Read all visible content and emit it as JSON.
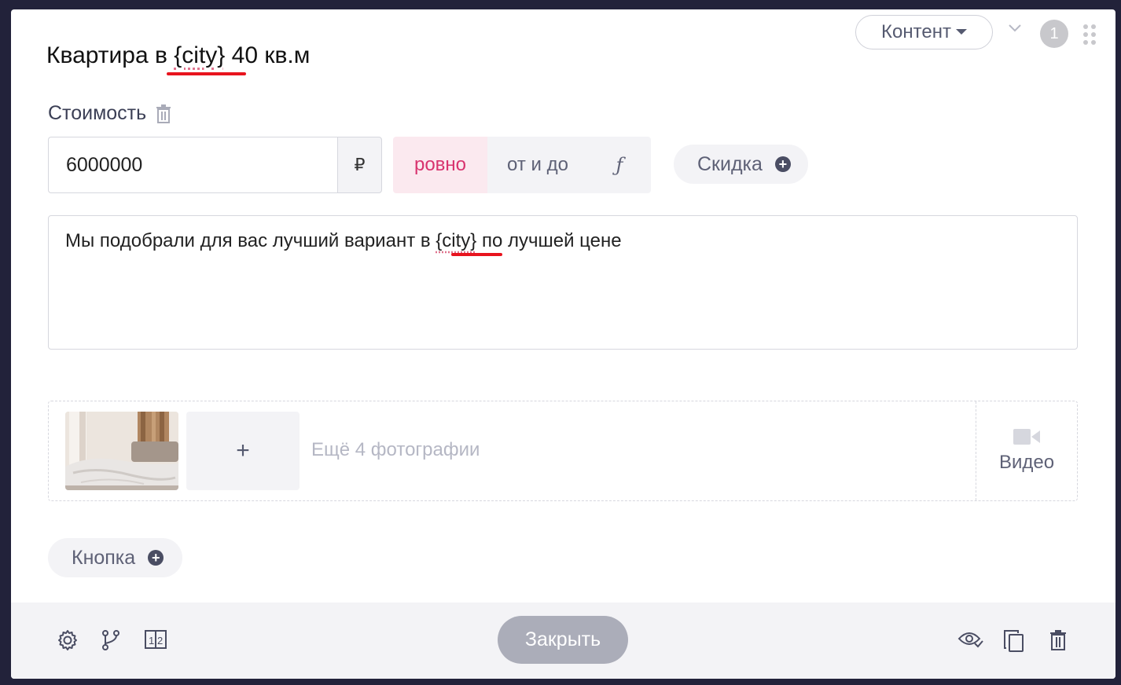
{
  "header": {
    "title_prefix": "Квартира ",
    "title_var_word": "в ",
    "title_var": "{city}",
    "title_suffix": " 40 кв.м",
    "content_dropdown": "Контент",
    "badge_count": "1"
  },
  "price": {
    "label": "Стоимость",
    "value": "6000000",
    "currency": "₽",
    "modes": [
      "ровно",
      "от и до",
      "ƒ"
    ],
    "active_mode": "ровно",
    "discount_label": "Скидка"
  },
  "description": {
    "text_prefix": "Мы подобрали для вас лучший вариант в ",
    "var": "{city}",
    "text_suffix": " по лучшей цене"
  },
  "media": {
    "add_symbol": "+",
    "more_photos": "Ещё 4 фотографии",
    "video_label": "Видео"
  },
  "button_pill": {
    "label": "Кнопка"
  },
  "footer": {
    "close_label": "Закрыть"
  },
  "colors": {
    "accent": "#d8336e",
    "underline": "#e8141e",
    "close_bg": "#abadb9"
  }
}
